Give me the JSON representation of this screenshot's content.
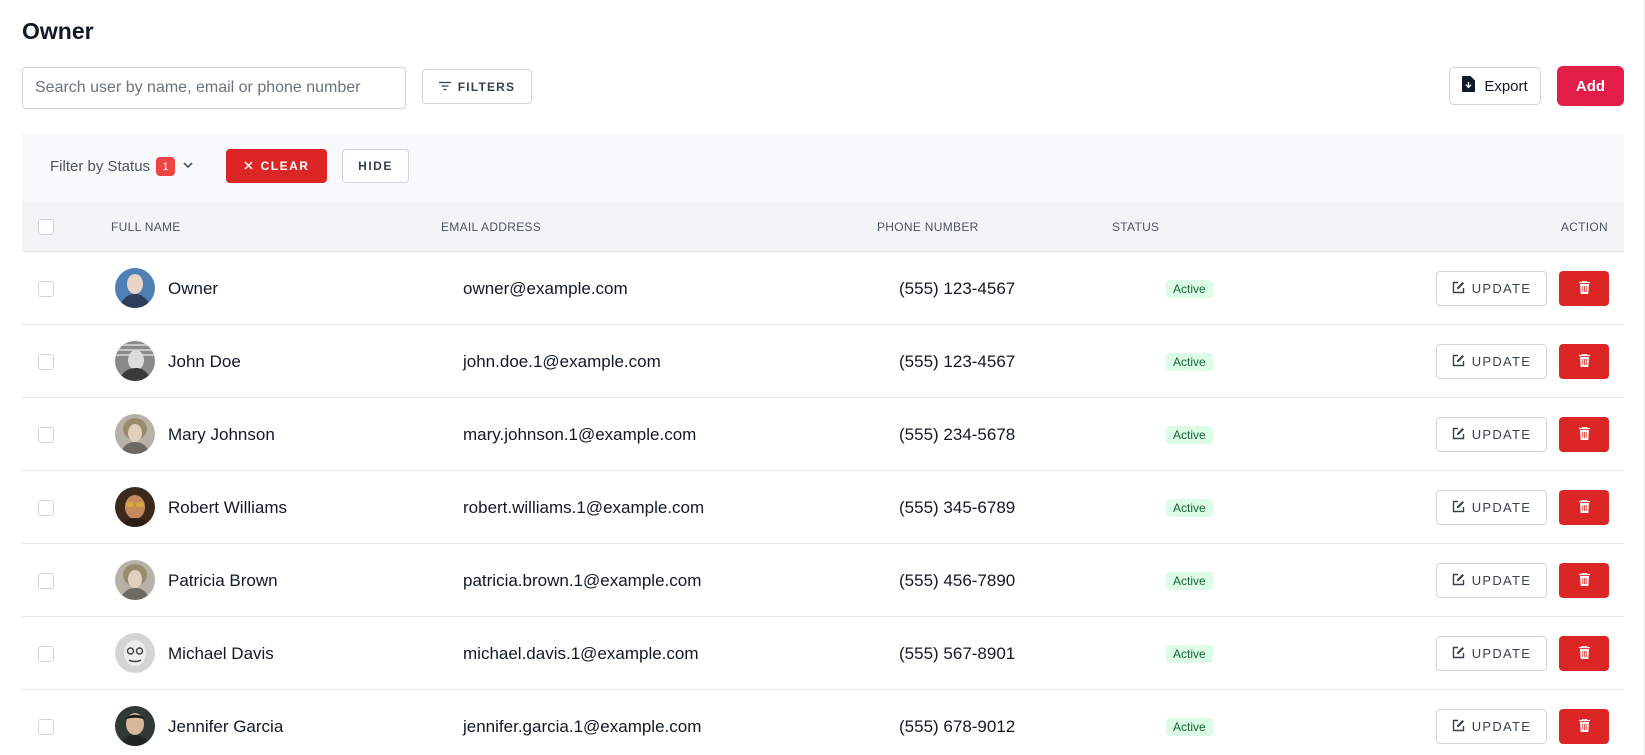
{
  "page": {
    "title": "Owner"
  },
  "toolbar": {
    "search_placeholder": "Search user by name, email or phone number",
    "filters_label": "FILTERS",
    "export_label": "Export",
    "add_label": "Add"
  },
  "filter_bar": {
    "status_label": "Filter by Status",
    "status_count": "1",
    "clear_label": "CLEAR",
    "hide_label": "HIDE"
  },
  "table": {
    "columns": {
      "full_name": "FULL NAME",
      "email": "EMAIL ADDRESS",
      "phone": "PHONE NUMBER",
      "status": "STATUS",
      "action": "ACTION"
    },
    "update_label": "UPDATE",
    "rows": [
      {
        "name": "Owner",
        "email": "owner@example.com",
        "phone": "(555) 123-4567",
        "status": "Active"
      },
      {
        "name": "John Doe",
        "email": "john.doe.1@example.com",
        "phone": "(555) 123-4567",
        "status": "Active"
      },
      {
        "name": "Mary Johnson",
        "email": "mary.johnson.1@example.com",
        "phone": "(555) 234-5678",
        "status": "Active"
      },
      {
        "name": "Robert Williams",
        "email": "robert.williams.1@example.com",
        "phone": "(555) 345-6789",
        "status": "Active"
      },
      {
        "name": "Patricia Brown",
        "email": "patricia.brown.1@example.com",
        "phone": "(555) 456-7890",
        "status": "Active"
      },
      {
        "name": "Michael Davis",
        "email": "michael.davis.1@example.com",
        "phone": "(555) 567-8901",
        "status": "Active"
      },
      {
        "name": "Jennifer Garcia",
        "email": "jennifer.garcia.1@example.com",
        "phone": "(555) 678-9012",
        "status": "Active"
      }
    ]
  },
  "colors": {
    "brand_add": "#e11d48",
    "danger": "#dc2626",
    "status_active_bg": "#dcfce7",
    "status_active_text": "#166534"
  },
  "icons": {
    "filters": "filter-lines-icon",
    "export": "file-download-icon",
    "clear": "close-icon",
    "dropdown": "chevron-down-icon",
    "update": "edit-icon",
    "delete": "trash-icon"
  }
}
